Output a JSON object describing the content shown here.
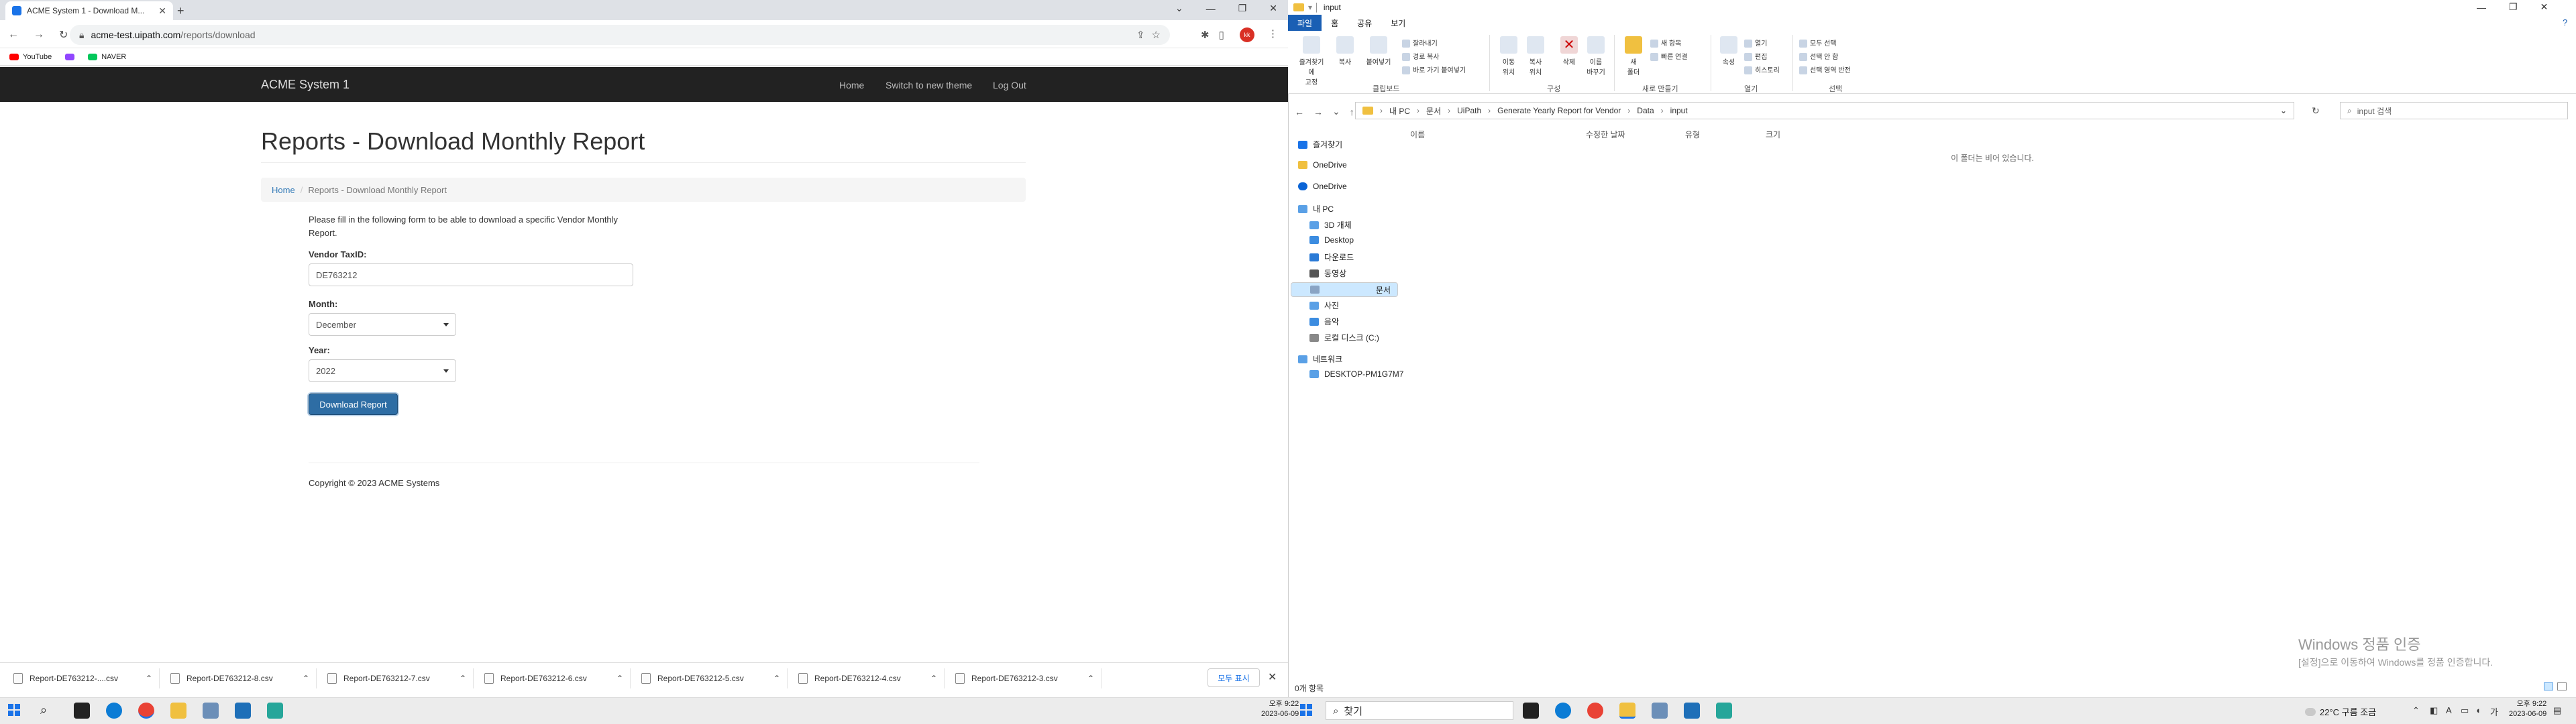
{
  "browser": {
    "tab_title": "ACME System 1 - Download M...",
    "url_host": "acme-test.uipath.com",
    "url_path": "/reports/download",
    "profile_initials": "kk",
    "bookmarks": [
      {
        "label": "YouTube",
        "color": "#ff0000"
      },
      {
        "label": "",
        "color": "#9146ff"
      },
      {
        "label": "NAVER",
        "color": "#03c75a"
      }
    ]
  },
  "page": {
    "brand": "ACME System 1",
    "nav": [
      "Home",
      "Switch to new theme",
      "Log Out"
    ],
    "title": "Reports - Download Monthly Report",
    "breadcrumb": {
      "home": "Home",
      "current": "Reports - Download Monthly Report"
    },
    "intro": "Please fill in the following form to be able to download a specific Vendor Monthly Report.",
    "form": {
      "vendor_label": "Vendor TaxID:",
      "vendor_value": "DE763212",
      "month_label": "Month:",
      "month_value": "December",
      "year_label": "Year:",
      "year_value": "2022",
      "submit": "Download Report"
    },
    "footer": "Copyright © 2023 ACME Systems"
  },
  "downloads": {
    "items": [
      "Report-DE763212-....csv",
      "Report-DE763212-8.csv",
      "Report-DE763212-7.csv",
      "Report-DE763212-6.csv",
      "Report-DE763212-5.csv",
      "Report-DE763212-4.csv",
      "Report-DE763212-3.csv"
    ],
    "show_all": "모두 표시"
  },
  "explorer": {
    "title": "input",
    "ribbon_tabs": [
      "파일",
      "홈",
      "공유",
      "보기"
    ],
    "ribbon": {
      "pin": "즐겨찾기에\n고정",
      "copy": "복사",
      "paste": "붙여넣기",
      "cut": "잘라내기",
      "copy_path": "경로 복사",
      "paste_shortcut": "바로 가기 붙여넣기",
      "move_to": "이동\n위치",
      "copy_to": "복사\n위치",
      "delete": "삭제",
      "rename": "이름\n바꾸기",
      "new_folder": "새\n폴더",
      "new_item": "새 항목",
      "easy_access": "빠른 연결",
      "properties": "속성",
      "open": "열기",
      "edit": "편집",
      "history": "히스토리",
      "select_all": "모두 선택",
      "select_none": "선택 안 함",
      "invert": "선택 영역 반전",
      "groups": [
        "클립보드",
        "구성",
        "새로 만들기",
        "열기",
        "선택"
      ]
    },
    "address": [
      "내 PC",
      "문서",
      "UiPath",
      "Generate Yearly Report for Vendor",
      "Data",
      "input"
    ],
    "search_placeholder": "input 검색",
    "sidebar": [
      "즐겨찾기",
      "OneDrive",
      "OneDrive",
      "내 PC",
      "3D 개체",
      "Desktop",
      "다운로드",
      "동영상",
      "문서",
      "사진",
      "음악",
      "로컬 디스크 (C:)",
      "네트워크",
      "DESKTOP-PM1G7M7"
    ],
    "columns": [
      "이름",
      "수정한 날짜",
      "유형",
      "크기"
    ],
    "empty_msg": "이 폴더는 비어 있습니다.",
    "status": "0개 항목",
    "watermark_title": "Windows 정품 인증",
    "watermark_sub": "[설정]으로 이동하여 Windows를 정품 인증합니다."
  },
  "taskbar": {
    "left_clock_time": "오후 9:22",
    "left_clock_date": "2023-06-09",
    "search": "찾기",
    "weather": "22°C  구름 조금",
    "ime": "A",
    "right_clock_time": "오후 9:22",
    "right_clock_date": "2023-06-09"
  }
}
